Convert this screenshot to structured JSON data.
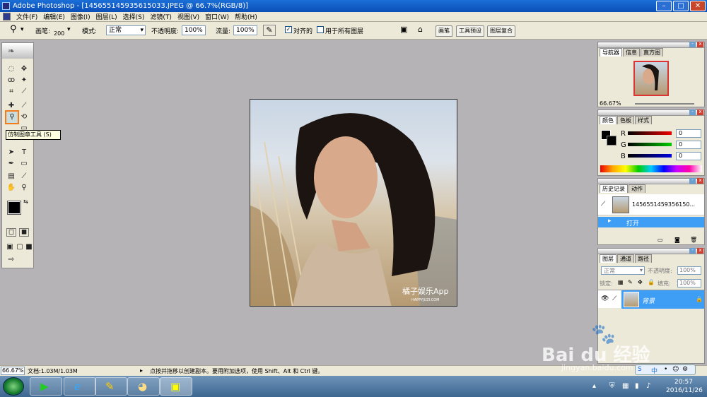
{
  "window": {
    "title": "Adobe Photoshop - [1456551459356150​33.JPEG @ 66.7%(RGB/8)]"
  },
  "menu": [
    "文件(F)",
    "编辑(E)",
    "图像(I)",
    "图层(L)",
    "选择(S)",
    "滤镜(T)",
    "视图(V)",
    "窗口(W)",
    "帮助(H)"
  ],
  "options": {
    "brush_label": "画笔:",
    "brush_size": "200",
    "mode_label": "模式:",
    "mode_value": "正常",
    "opacity_label": "不透明度:",
    "opacity_value": "100%",
    "flow_label": "流量:",
    "flow_value": "100%",
    "aligned_label": "对齐的",
    "all_layers_label": "用于所有图层",
    "aligned_checked": true,
    "all_layers_checked": false
  },
  "wells": [
    "画笔",
    "工具预设",
    "图层复合"
  ],
  "tooltip": "仿制图章工具 (S)",
  "icons": {
    "rubber_stamp": "rubber-stamp-icon",
    "magnifier": "zoom-icon",
    "hand": "hand-icon",
    "text": "type-icon"
  },
  "navigator": {
    "tabs": [
      "导航器",
      "信息",
      "直方图"
    ],
    "zoom": "66.67%"
  },
  "color_panel": {
    "tabs": [
      "颜色",
      "色板",
      "样式"
    ],
    "channels": [
      {
        "name": "R",
        "value": "0"
      },
      {
        "name": "G",
        "value": "0"
      },
      {
        "name": "B",
        "value": "0"
      }
    ]
  },
  "history": {
    "tabs": [
      "历史记录",
      "动作"
    ],
    "snapshot_name": "1456551459356150...",
    "steps": [
      "打开"
    ]
  },
  "layers": {
    "tabs": [
      "图层",
      "通道",
      "路径"
    ],
    "blend": "正常",
    "opacity_label": "不透明度:",
    "opacity_value": "100%",
    "lock_label": "锁定:",
    "fill_label": "填充:",
    "fill_value": "100%",
    "layer_name": "背景"
  },
  "canvas": {
    "watermark": "橘子娱乐App",
    "watermark_sub": "HAPPYJUZI.COM"
  },
  "status": {
    "zoom": "66.67%",
    "doc": "文档:1.03M/1.03M",
    "hint": "点按并拖移以创建副本。要用附加选项，使用 Shift、Alt 和 Ctrl 键。"
  },
  "taskbar": {
    "time": "20:57",
    "date": "2016/11/26",
    "ime": "中"
  },
  "site_watermark": {
    "brand": "Bai du 经验",
    "url": "jingyan.baidu.com"
  },
  "colors": {
    "accent": "#3a8ee6",
    "title": "#0b4fb8",
    "selected": "#3e9ef6"
  }
}
